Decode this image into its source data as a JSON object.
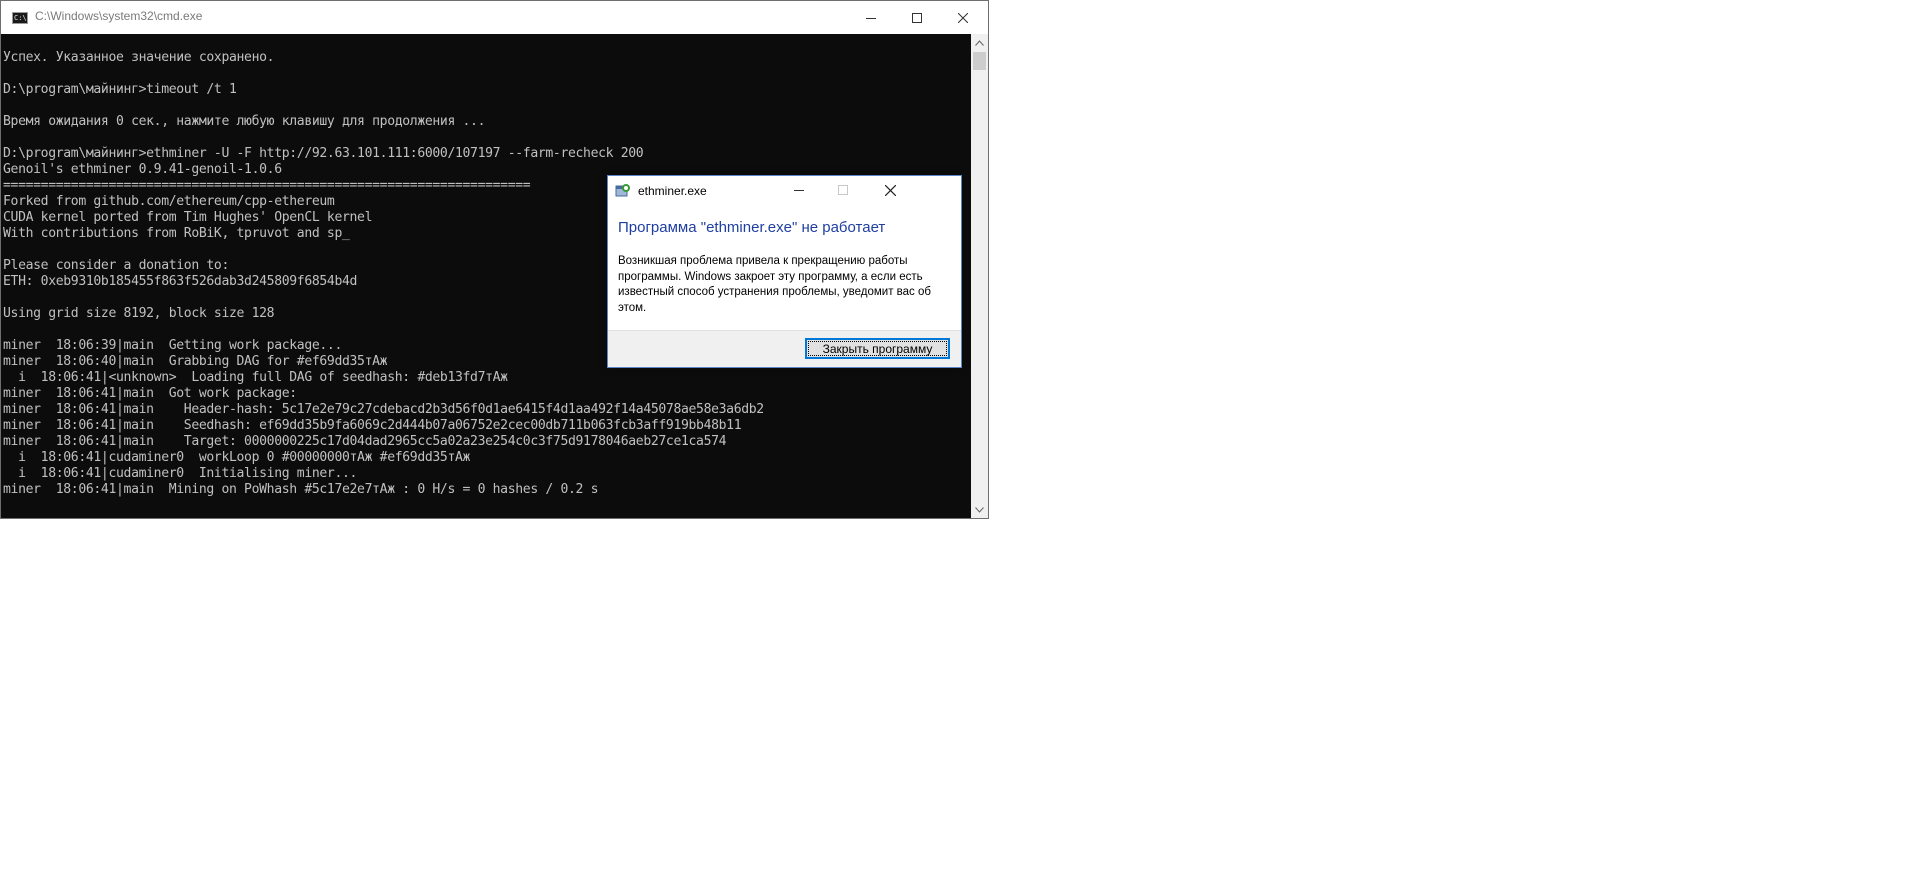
{
  "cmd_window": {
    "title": "C:\\Windows\\system32\\cmd.exe",
    "icon": "cmd-icon",
    "icon_glyph": "C:\\",
    "console_lines": [
      "Успех. Указанное значение сохранено.",
      "",
      "D:\\program\\майнинг>timeout /t 1",
      "",
      "Время ожидания 0 сек., нажмите любую клавишу для продолжения ...",
      "",
      "D:\\program\\майнинг>ethminer -U -F http://92.63.101.111:6000/107197 --farm-recheck 200",
      "Genoil's ethminer 0.9.41-genoil-1.0.6",
      "======================================================================",
      "Forked from github.com/ethereum/cpp-ethereum",
      "CUDA kernel ported from Tim Hughes' OpenCL kernel",
      "With contributions from RoBiK, tpruvot and sp_",
      "",
      "Please consider a donation to:",
      "ETH: 0xeb9310b185455f863f526dab3d245809f6854b4d",
      "",
      "Using grid size 8192, block size 128",
      "",
      "miner  18:06:39|main  Getting work package...",
      "miner  18:06:40|main  Grabbing DAG for #ef69dd35тАж",
      "  i  18:06:41|<unknown>  Loading full DAG of seedhash: #deb13fd7тАж",
      "miner  18:06:41|main  Got work package:",
      "miner  18:06:41|main    Header-hash: 5c17e2e79c27cdebacd2b3d56f0d1ae6415f4d1aa492f14a45078ae58e3a6db2",
      "miner  18:06:41|main    Seedhash: ef69dd35b9fa6069c2d444b07a06752e2cec00db711b063fcb3aff919bb48b11",
      "miner  18:06:41|main    Target: 0000000225c17d04dad2965cc5a02a23e254c0c3f75d9178046aeb27ce1ca574",
      "  i  18:06:41|cudaminer0  workLoop 0 #00000000тАж #ef69dd35тАж",
      "  i  18:06:41|cudaminer0  Initialising miner...",
      "miner  18:06:41|main  Mining on PoWhash #5c17e2e7тАж : 0 H/s = 0 hashes / 0.2 s"
    ],
    "colors": {
      "console_bg": "#0c0c0c",
      "console_fg": "#c0c0c0"
    }
  },
  "error_dialog": {
    "title": "ethminer.exe",
    "heading": "Программа \"ethminer.exe\" не работает",
    "message": "Возникшая проблема привела к прекращению работы программы. Windows закроет эту программу, а если есть известный способ устранения проблемы, уведомит вас об этом.",
    "button_label": "Закрыть программу",
    "colors": {
      "heading": "#1f3fa0",
      "button_focus": "#0078d7"
    }
  }
}
